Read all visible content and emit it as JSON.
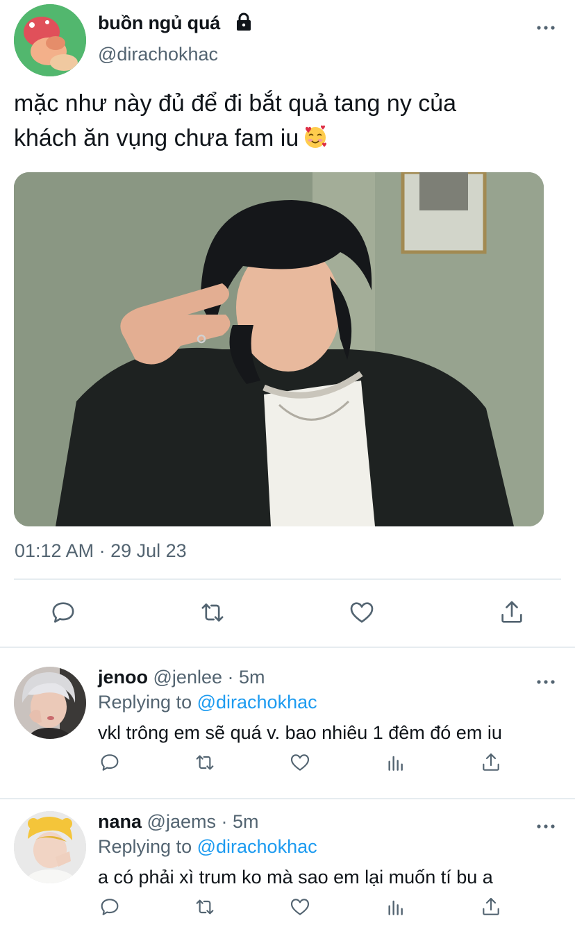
{
  "tweet": {
    "display_name": "buồn ngủ quá",
    "handle": "@dirachokhac",
    "text_line1": "mặc như này đủ để đi bắt quả tang ny của",
    "text_line2": "khách ăn vụng chưa fam iu",
    "emoji": "smiling-face-with-hearts",
    "photo": "portrait-photo",
    "timestamp": "01:12 AM · 29 Jul 23"
  },
  "actions": [
    "reply-icon",
    "retweet-icon",
    "like-icon",
    "share-icon"
  ],
  "replies": [
    {
      "name": "jenoo",
      "handle": "@jenlee",
      "time": "· 5m",
      "replying_prefix": "Replying to",
      "replying_to": "@dirachokhac",
      "text": "vkl trông em sẽ quá v. bao nhiêu 1 đêm đó em iu"
    },
    {
      "name": "nana",
      "handle": "@jaems",
      "time": "· 5m",
      "replying_prefix": "Replying to",
      "replying_to": "@dirachokhac",
      "text": "a có phải xì trum ko mà sao em lại muốn tí bu a"
    }
  ],
  "reply_actions": [
    "reply-icon",
    "retweet-icon",
    "like-icon",
    "analytics-icon",
    "share-icon"
  ],
  "colors": {
    "secondary": "#536471",
    "link": "#1d9bf0",
    "divider": "#e6ecf0"
  }
}
